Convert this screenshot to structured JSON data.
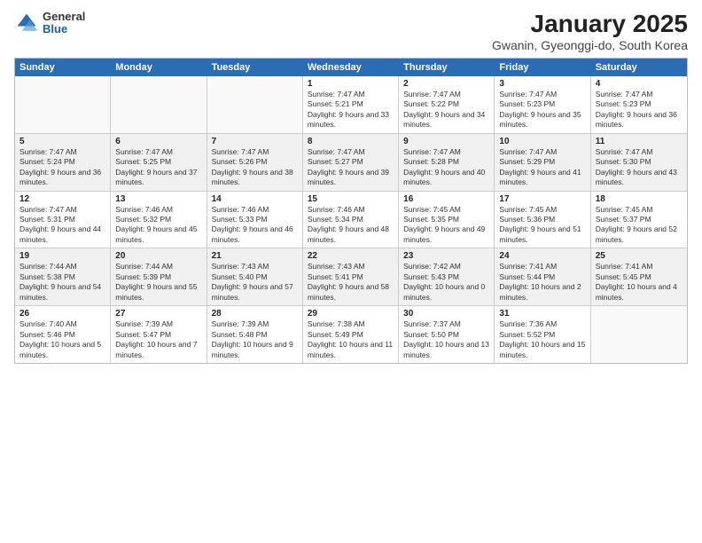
{
  "logo": {
    "general": "General",
    "blue": "Blue"
  },
  "title": "January 2025",
  "subtitle": "Gwanin, Gyeonggi-do, South Korea",
  "days": [
    "Sunday",
    "Monday",
    "Tuesday",
    "Wednesday",
    "Thursday",
    "Friday",
    "Saturday"
  ],
  "weeks": [
    [
      {
        "num": "",
        "text": "",
        "empty": true
      },
      {
        "num": "",
        "text": "",
        "empty": true
      },
      {
        "num": "",
        "text": "",
        "empty": true
      },
      {
        "num": "1",
        "text": "Sunrise: 7:47 AM\nSunset: 5:21 PM\nDaylight: 9 hours and 33 minutes."
      },
      {
        "num": "2",
        "text": "Sunrise: 7:47 AM\nSunset: 5:22 PM\nDaylight: 9 hours and 34 minutes."
      },
      {
        "num": "3",
        "text": "Sunrise: 7:47 AM\nSunset: 5:23 PM\nDaylight: 9 hours and 35 minutes."
      },
      {
        "num": "4",
        "text": "Sunrise: 7:47 AM\nSunset: 5:23 PM\nDaylight: 9 hours and 36 minutes."
      }
    ],
    [
      {
        "num": "5",
        "text": "Sunrise: 7:47 AM\nSunset: 5:24 PM\nDaylight: 9 hours and 36 minutes."
      },
      {
        "num": "6",
        "text": "Sunrise: 7:47 AM\nSunset: 5:25 PM\nDaylight: 9 hours and 37 minutes."
      },
      {
        "num": "7",
        "text": "Sunrise: 7:47 AM\nSunset: 5:26 PM\nDaylight: 9 hours and 38 minutes."
      },
      {
        "num": "8",
        "text": "Sunrise: 7:47 AM\nSunset: 5:27 PM\nDaylight: 9 hours and 39 minutes."
      },
      {
        "num": "9",
        "text": "Sunrise: 7:47 AM\nSunset: 5:28 PM\nDaylight: 9 hours and 40 minutes."
      },
      {
        "num": "10",
        "text": "Sunrise: 7:47 AM\nSunset: 5:29 PM\nDaylight: 9 hours and 41 minutes."
      },
      {
        "num": "11",
        "text": "Sunrise: 7:47 AM\nSunset: 5:30 PM\nDaylight: 9 hours and 43 minutes."
      }
    ],
    [
      {
        "num": "12",
        "text": "Sunrise: 7:47 AM\nSunset: 5:31 PM\nDaylight: 9 hours and 44 minutes."
      },
      {
        "num": "13",
        "text": "Sunrise: 7:46 AM\nSunset: 5:32 PM\nDaylight: 9 hours and 45 minutes."
      },
      {
        "num": "14",
        "text": "Sunrise: 7:46 AM\nSunset: 5:33 PM\nDaylight: 9 hours and 46 minutes."
      },
      {
        "num": "15",
        "text": "Sunrise: 7:46 AM\nSunset: 5:34 PM\nDaylight: 9 hours and 48 minutes."
      },
      {
        "num": "16",
        "text": "Sunrise: 7:45 AM\nSunset: 5:35 PM\nDaylight: 9 hours and 49 minutes."
      },
      {
        "num": "17",
        "text": "Sunrise: 7:45 AM\nSunset: 5:36 PM\nDaylight: 9 hours and 51 minutes."
      },
      {
        "num": "18",
        "text": "Sunrise: 7:45 AM\nSunset: 5:37 PM\nDaylight: 9 hours and 52 minutes."
      }
    ],
    [
      {
        "num": "19",
        "text": "Sunrise: 7:44 AM\nSunset: 5:38 PM\nDaylight: 9 hours and 54 minutes."
      },
      {
        "num": "20",
        "text": "Sunrise: 7:44 AM\nSunset: 5:39 PM\nDaylight: 9 hours and 55 minutes."
      },
      {
        "num": "21",
        "text": "Sunrise: 7:43 AM\nSunset: 5:40 PM\nDaylight: 9 hours and 57 minutes."
      },
      {
        "num": "22",
        "text": "Sunrise: 7:43 AM\nSunset: 5:41 PM\nDaylight: 9 hours and 58 minutes."
      },
      {
        "num": "23",
        "text": "Sunrise: 7:42 AM\nSunset: 5:43 PM\nDaylight: 10 hours and 0 minutes."
      },
      {
        "num": "24",
        "text": "Sunrise: 7:41 AM\nSunset: 5:44 PM\nDaylight: 10 hours and 2 minutes."
      },
      {
        "num": "25",
        "text": "Sunrise: 7:41 AM\nSunset: 5:45 PM\nDaylight: 10 hours and 4 minutes."
      }
    ],
    [
      {
        "num": "26",
        "text": "Sunrise: 7:40 AM\nSunset: 5:46 PM\nDaylight: 10 hours and 5 minutes."
      },
      {
        "num": "27",
        "text": "Sunrise: 7:39 AM\nSunset: 5:47 PM\nDaylight: 10 hours and 7 minutes."
      },
      {
        "num": "28",
        "text": "Sunrise: 7:39 AM\nSunset: 5:48 PM\nDaylight: 10 hours and 9 minutes."
      },
      {
        "num": "29",
        "text": "Sunrise: 7:38 AM\nSunset: 5:49 PM\nDaylight: 10 hours and 11 minutes."
      },
      {
        "num": "30",
        "text": "Sunrise: 7:37 AM\nSunset: 5:50 PM\nDaylight: 10 hours and 13 minutes."
      },
      {
        "num": "31",
        "text": "Sunrise: 7:36 AM\nSunset: 5:52 PM\nDaylight: 10 hours and 15 minutes."
      },
      {
        "num": "",
        "text": "",
        "empty": true
      }
    ]
  ]
}
